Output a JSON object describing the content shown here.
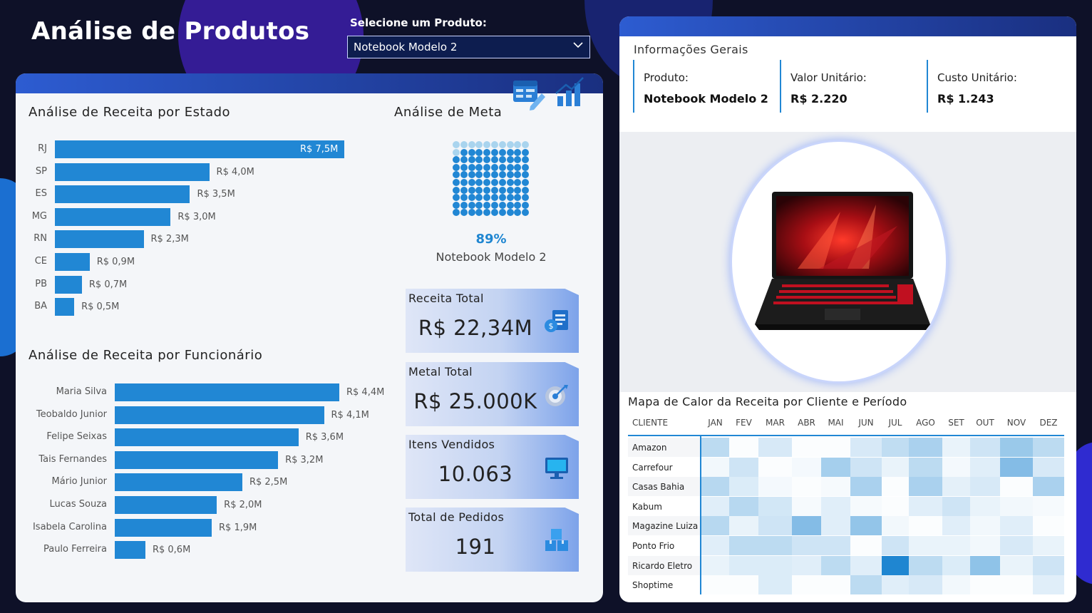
{
  "header": {
    "title": "Análise de Produtos",
    "select_label": "Selecione um Produto:",
    "select_value": "Notebook Modelo 2"
  },
  "state_chart": {
    "title": "Análise de Receita por Estado",
    "chart_data": {
      "type": "bar",
      "orientation": "horizontal",
      "categories": [
        "RJ",
        "SP",
        "ES",
        "MG",
        "RN",
        "CE",
        "PB",
        "BA"
      ],
      "values": [
        7.5,
        4.0,
        3.5,
        3.0,
        2.3,
        0.9,
        0.7,
        0.5
      ],
      "labels": [
        "R$ 7,5M",
        "R$ 4,0M",
        "R$ 3,5M",
        "R$ 3,0M",
        "R$ 2,3M",
        "R$ 0,9M",
        "R$ 0,7M",
        "R$ 0,5M"
      ],
      "color": "#2187d4"
    }
  },
  "employee_chart": {
    "title": "Análise de Receita por Funcionário",
    "chart_data": {
      "type": "bar",
      "orientation": "horizontal",
      "categories": [
        "Maria Silva",
        "Teobaldo Junior",
        "Felipe Seixas",
        "Tais Fernandes",
        "Mário Junior",
        "Lucas Souza",
        "Isabela Carolina",
        "Paulo Ferreira"
      ],
      "values": [
        4.4,
        4.1,
        3.6,
        3.2,
        2.5,
        2.0,
        1.9,
        0.6
      ],
      "labels": [
        "R$ 4,4M",
        "R$ 4,1M",
        "R$ 3,6M",
        "R$ 3,2M",
        "R$ 2,5M",
        "R$ 2,0M",
        "R$ 1,9M",
        "R$ 0,6M"
      ],
      "color": "#2187d4"
    }
  },
  "goal": {
    "title": "Análise de Meta",
    "percent": 89,
    "percent_label": "89%",
    "product": "Notebook Modelo 2",
    "filled_color": "#2187d4",
    "empty_color": "#a9d4ee"
  },
  "kpis": [
    {
      "label": "Receita Total",
      "value": "R$ 22,34M",
      "icon": "money-document-icon"
    },
    {
      "label": "Metal Total",
      "value": "R$ 25.000K",
      "icon": "target-icon"
    },
    {
      "label": "Itens Vendidos",
      "value": "10.063",
      "icon": "monitor-icon"
    },
    {
      "label": "Total de Pedidos",
      "value": "191",
      "icon": "boxes-icon"
    }
  ],
  "toolbar_icons": [
    "edit-table-icon",
    "bar-chart-icon"
  ],
  "info": {
    "title": "Informações Gerais",
    "cols": [
      {
        "label": "Produto:",
        "value": "Notebook Modelo 2"
      },
      {
        "label": "Valor Unitário:",
        "value": "R$ 2.220"
      },
      {
        "label": "Custo Unitário:",
        "value": "R$ 1.243"
      }
    ]
  },
  "product_image": {
    "icon": "laptop-image"
  },
  "heatmap": {
    "title": "Mapa de Calor da Receita por Cliente e Período",
    "header_client": "CLIENTE",
    "months": [
      "JAN",
      "FEV",
      "MAR",
      "ABR",
      "MAI",
      "JUN",
      "JUL",
      "AGO",
      "SET",
      "OUT",
      "NOV",
      "DEZ"
    ],
    "clients": [
      "Amazon",
      "Carrefour",
      "Casas Bahia",
      "Kabum",
      "Magazine Luiza",
      "Ponto Frio",
      "Ricardo Eletro",
      "Shoptime"
    ],
    "intensity": [
      [
        0.3,
        0.02,
        0.18,
        0.02,
        0.02,
        0.18,
        0.28,
        0.38,
        0.1,
        0.22,
        0.45,
        0.3
      ],
      [
        0.06,
        0.22,
        0.02,
        0.05,
        0.4,
        0.22,
        0.1,
        0.3,
        0.05,
        0.14,
        0.55,
        0.18
      ],
      [
        0.32,
        0.16,
        0.05,
        0.02,
        0.04,
        0.38,
        0.02,
        0.38,
        0.12,
        0.18,
        0.02,
        0.38
      ],
      [
        0.14,
        0.32,
        0.2,
        0.04,
        0.14,
        0.04,
        0.02,
        0.14,
        0.22,
        0.1,
        0.06,
        0.04
      ],
      [
        0.32,
        0.1,
        0.22,
        0.55,
        0.14,
        0.48,
        0.06,
        0.02,
        0.14,
        0.06,
        0.14,
        0.02
      ],
      [
        0.14,
        0.3,
        0.3,
        0.22,
        0.22,
        0.02,
        0.22,
        0.1,
        0.1,
        0.06,
        0.18,
        0.1
      ],
      [
        0.1,
        0.16,
        0.16,
        0.14,
        0.3,
        0.14,
        1.0,
        0.3,
        0.16,
        0.5,
        0.1,
        0.22
      ],
      [
        0.02,
        0.02,
        0.16,
        0.02,
        0.02,
        0.3,
        0.14,
        0.18,
        0.06,
        0.02,
        0.02,
        0.14
      ]
    ],
    "low_color": "#ffffff",
    "high_color": "#1f86d1"
  }
}
